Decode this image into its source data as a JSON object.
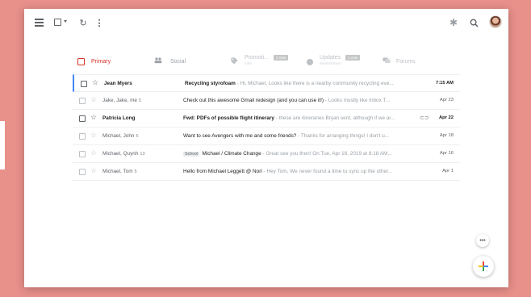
{
  "toolbar": {
    "menu_icon": "hamburger-menu-icon",
    "select_icon": "checkbox-icon",
    "refresh_icon": "refresh-icon",
    "more_icon": "more-vert-icon",
    "settings_icon": "gear-icon",
    "search_icon": "search-icon",
    "refresh_glyph": "↻",
    "more_glyph": "⋮",
    "gear_glyph": "✱"
  },
  "tabs": [
    {
      "label": "Primary",
      "color": "#d93025",
      "selected": true
    },
    {
      "label": "Social",
      "icon_glyph": "👥"
    },
    {
      "label": "Promoti...",
      "badge": "1 new",
      "sub": "Intel"
    },
    {
      "label": "Updates",
      "badge": "1 new",
      "sub": "WeatherBeat"
    },
    {
      "label": "Forums",
      "icon_glyph": "💬"
    }
  ],
  "emails": [
    {
      "sender": "Jean Myers",
      "count": "",
      "subject": "Recycling styrofoam",
      "snippet": " - Hi, Michael, Looks like there is a nearby community recycling eve...",
      "date": "7:15 AM",
      "unread": true,
      "selected": true,
      "label": ""
    },
    {
      "sender": "Jake, Jake, me",
      "count": "5",
      "subject": "Check out this awesome Gmail redesign (and you can use it!)",
      "snippet": " - Looks mostly like Inbox T...",
      "date": "Apr 23",
      "unread": false,
      "label": ""
    },
    {
      "sender": "Patricia Long",
      "count": "",
      "subject": "Fwd: PDFs of possible flight itinerary",
      "snippet": " - these are itineraries Bryan sent, although if we ar...",
      "date": "Apr 22",
      "unread": true,
      "label": "",
      "attachment": "⊂⊃"
    },
    {
      "sender": "Michael, John",
      "count": "5",
      "subject": "Want to see Avengers with me and some friends?",
      "snippet": " - Thanks for arranging things! I don't u...",
      "date": "Apr 18",
      "unread": false,
      "label": ""
    },
    {
      "sender": "Michael, Quynh",
      "count": "13",
      "subject": "Michael / Climate Change",
      "snippet": " - Great see you then! On Tue, Apr 16, 2019 at 8:18 AM...",
      "date": "Apr 16",
      "unread": false,
      "label": "School"
    },
    {
      "sender": "Michael, Tom",
      "count": "5",
      "subject": "Hello from Michael Leggett @ Nori",
      "snippet": " - Hey Tom, We never found a time to sync up the other...",
      "date": "Apr 1",
      "unread": false,
      "label": ""
    }
  ],
  "fab": {
    "more_glyph": "•••"
  },
  "colors": {
    "background": "#e8908a",
    "accent_red": "#d93025",
    "selected_bar": "#4285f4"
  }
}
